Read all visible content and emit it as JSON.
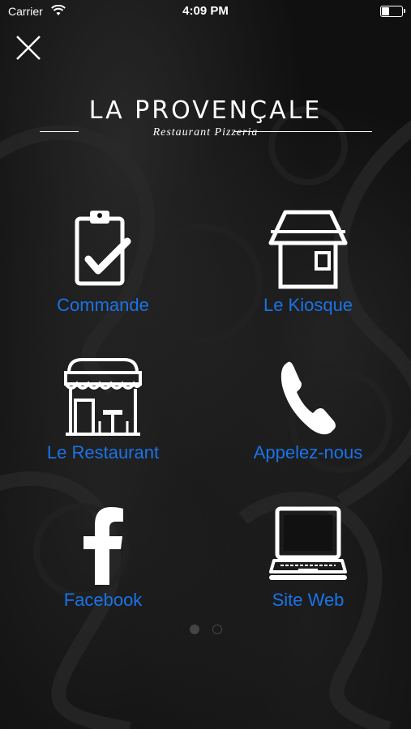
{
  "status_bar": {
    "carrier": "Carrier",
    "time": "4:09 PM"
  },
  "logo": {
    "title": "LA PROVENÇALE",
    "subtitle": "Restaurant Pizzeria"
  },
  "menu": [
    {
      "label": "Commande",
      "icon": "clipboard-check-icon"
    },
    {
      "label": "Le Kiosque",
      "icon": "kiosk-icon"
    },
    {
      "label": "Le Restaurant",
      "icon": "storefront-icon"
    },
    {
      "label": "Appelez-nous",
      "icon": "phone-icon"
    },
    {
      "label": "Facebook",
      "icon": "facebook-icon"
    },
    {
      "label": "Site Web",
      "icon": "laptop-icon"
    }
  ],
  "colors": {
    "accent": "#1a73e8",
    "background": "#101010",
    "foreground": "#ffffff"
  },
  "pager": {
    "pages": 2,
    "current": 1
  }
}
